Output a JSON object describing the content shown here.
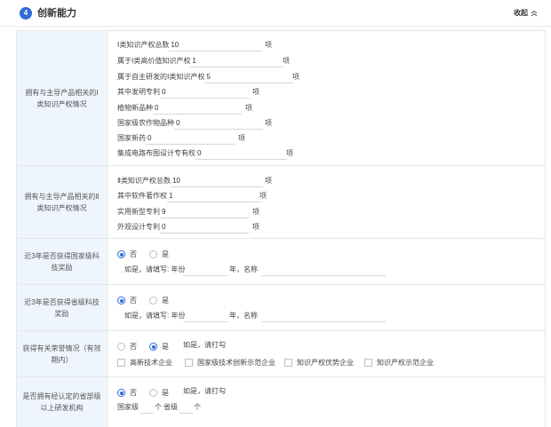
{
  "header": {
    "step": "4",
    "title": "创新能力",
    "collapse_label": "收起"
  },
  "ip1": {
    "label": "拥有与主导产品相关的Ⅰ类知识产权情况",
    "fields": [
      {
        "label": "Ⅰ类知识产权总数",
        "value": "10",
        "unit": "项"
      },
      {
        "label": "属于Ⅰ类高价值知识产权",
        "value": "1",
        "unit": "项"
      },
      {
        "label": "属于自主研发的Ⅰ类知识产权",
        "value": "5",
        "unit": "项"
      },
      {
        "label": "其中发明专利",
        "value": "0",
        "unit": "项"
      },
      {
        "label": "植物新品种",
        "value": "0",
        "unit": "项"
      },
      {
        "label": "国家级农作物品种",
        "value": "0",
        "unit": "项"
      },
      {
        "label": "国家新药",
        "value": "0",
        "unit": "项"
      },
      {
        "label": "集成电路布图设计专有权",
        "value": "0",
        "unit": "项"
      }
    ]
  },
  "ip2": {
    "label": "拥有与主导产品相关的Ⅱ类知识产权情况",
    "fields": [
      {
        "label": "Ⅱ类知识产权总数",
        "value": "10",
        "unit": "项"
      },
      {
        "label": "其中软件著作权",
        "value": "1",
        "unit": "项"
      },
      {
        "label": "实用新型专利",
        "value": "9",
        "unit": "项"
      },
      {
        "label": "外观设计专利",
        "value": "0",
        "unit": "项"
      }
    ]
  },
  "national_award": {
    "label": "近3年是否获得国家级科技奖励",
    "no": "否",
    "yes": "是",
    "fill_prompt": "如是，请填写: 年份",
    "year_suffix": "年，名称"
  },
  "provincial_award": {
    "label": "近3年是否获得省级科技奖励",
    "no": "否",
    "yes": "是",
    "fill_prompt": "如是，请填写: 年份",
    "year_suffix": "年，名称"
  },
  "honors": {
    "label": "获得有关荣誉情况（有效期内）",
    "no": "否",
    "yes": "是",
    "hint": "如是，请打勾",
    "options": [
      "高新技术企业",
      "国家级技术创新示范企业",
      "知识产权优势企业",
      "知识产权示范企业"
    ]
  },
  "rd_center": {
    "label": "是否拥有经认定的省部级以上研发机构",
    "no": "否",
    "yes": "是",
    "hint": "如是，请打勾",
    "national_label": "国家级",
    "national_unit": "个",
    "provincial_label": "省级",
    "provincial_unit": "个"
  },
  "colors": {
    "accent": "#2f6bd8",
    "label_bg": "#eef5fd",
    "border": "#e3e7ee"
  },
  "icons": {
    "collapse": "chevron-double-up-icon"
  }
}
